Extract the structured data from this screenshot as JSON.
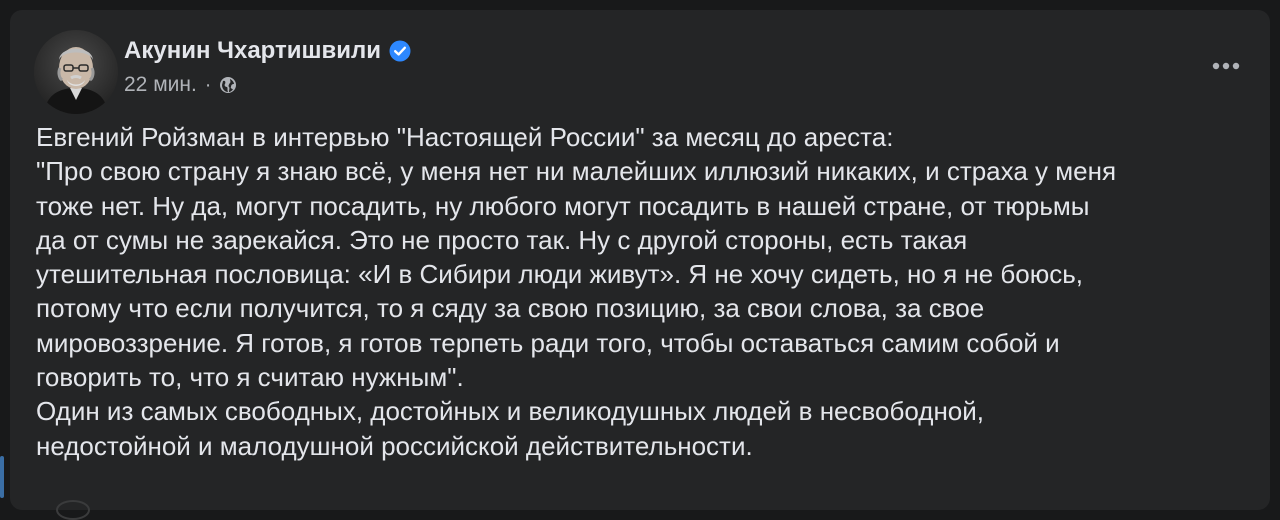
{
  "post": {
    "author": "Акунин Чхартишвили",
    "verified": true,
    "time": "22 мин.",
    "separator": "·",
    "audience_icon": "globe-icon",
    "more_icon": "more-horizontal-icon",
    "lines": [
      "Евгений Ройзман в интервью \"Настоящей России\"  за месяц до ареста:",
      "\"Про свою страну я знаю всё, у меня нет ни малейших иллюзий никаких, и страха у меня",
      "тоже нет. Ну да, могут посадить, ну любого могут посадить в нашей стране, от тюрьмы",
      "да от сумы не зарекайся. Это не просто так. Ну с другой стороны, есть такая",
      "утешительная пословица: «И в Сибири люди живут». Я не хочу сидеть, но я не боюсь,",
      "потому что если получится, то я сяду за свою позицию, за свои слова, за свое",
      "мировоззрение. Я готов, я готов терпеть ради того, чтобы оставаться самим собой и",
      "говорить то, что я считаю нужным\".",
      "Один из самых свободных, достойных и великодушных людей в несвободной,",
      "недостойной и малодушной российской действительности."
    ]
  },
  "colors": {
    "background": "#18191a",
    "card": "#242526",
    "text_primary": "#e4e6eb",
    "text_secondary": "#b0b3b8",
    "verified": "#2d88ff"
  }
}
